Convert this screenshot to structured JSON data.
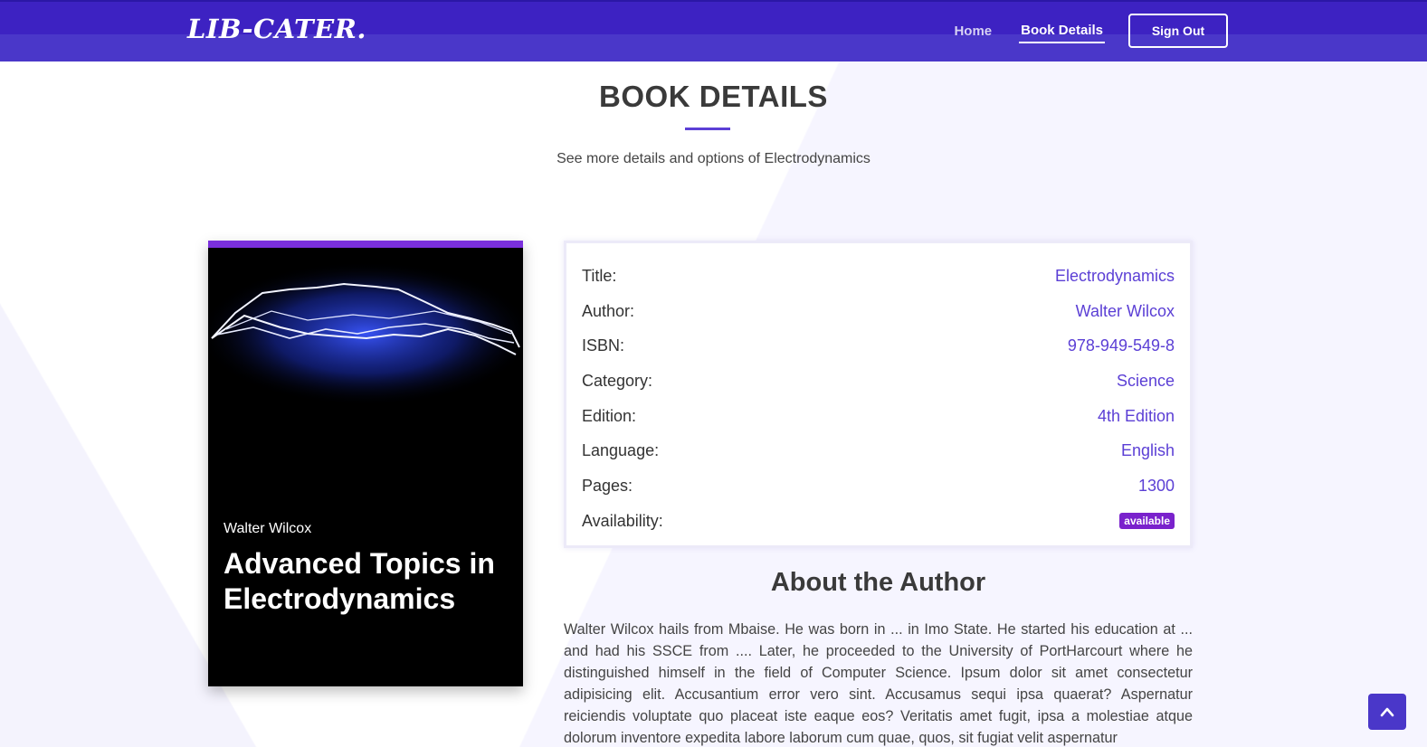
{
  "header": {
    "logo": "LIB-CATER.",
    "nav": {
      "home": "Home",
      "book_details": "Book Details",
      "sign_out": "Sign Out"
    }
  },
  "section": {
    "title": "BOOK DETAILS",
    "subtitle": "See more details and options of Electrodynamics"
  },
  "cover": {
    "author": "Walter Wilcox",
    "title": "Advanced Topics in Electrodynamics"
  },
  "details": [
    {
      "label": "Title:",
      "value": "Electrodynamics"
    },
    {
      "label": "Author:",
      "value": "Walter Wilcox"
    },
    {
      "label": "ISBN:",
      "value": "978-949-549-8"
    },
    {
      "label": "Category:",
      "value": "Science"
    },
    {
      "label": "Edition:",
      "value": "4th Edition"
    },
    {
      "label": "Language:",
      "value": "English"
    },
    {
      "label": "Pages:",
      "value": "1300"
    },
    {
      "label": "Availability:",
      "value": "available"
    }
  ],
  "about": {
    "title": "About the Author",
    "text": "Walter Wilcox hails from Mbaise. He was born in ... in Imo State. He started his education at ... and had his SSCE from .... Later, he proceeded to the University of PortHarcourt where he distinguished himself in the field of Computer Science. Ipsum dolor sit amet consectetur adipisicing elit. Accusantium error vero sint. Accusamus sequi ipsa quaerat? Aspernatur reiciendis voluptate quo placeat iste eaque eos? Veritatis amet fugit, ipsa a molestiae atque dolorum inventore expedita labore laborum cum quae, quos, sit fugiat velit aspernatur"
  },
  "colors": {
    "brand": "#3d22c2",
    "accent": "#5b3fd5",
    "badge": "#7a22cc"
  },
  "icons": {
    "back_to_top": "chevron-up-icon"
  }
}
